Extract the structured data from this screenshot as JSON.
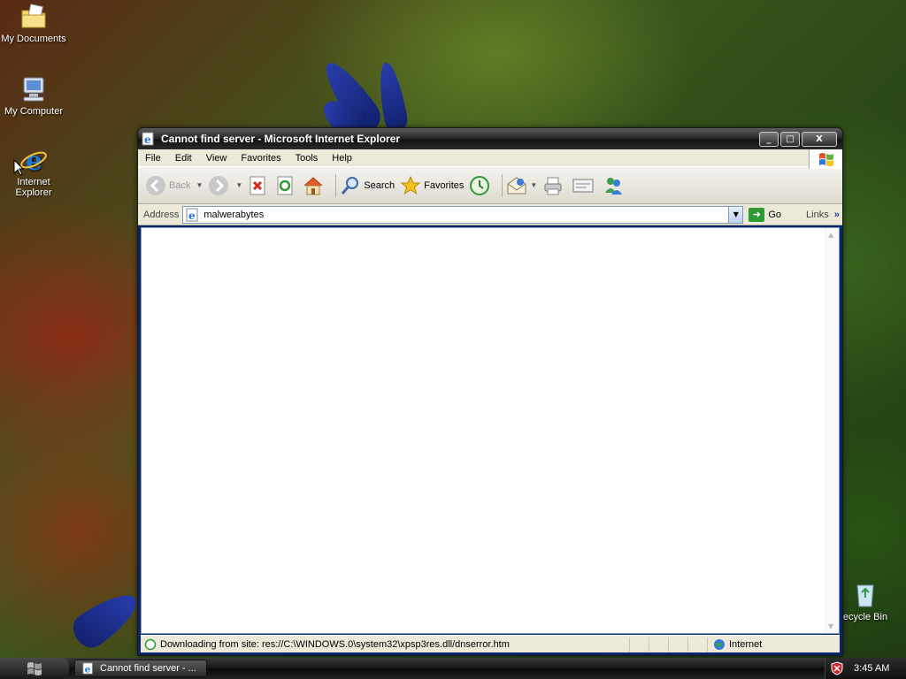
{
  "desktop": {
    "icons": [
      {
        "label": "My Documents",
        "icon": "folder-document-icon"
      },
      {
        "label": "My Computer",
        "icon": "computer-icon"
      },
      {
        "label": "Internet Explorer",
        "icon": "internet-explorer-icon"
      },
      {
        "label": "ecycle Bin",
        "icon": "recycle-bin-icon"
      }
    ]
  },
  "window": {
    "title": "Cannot find server - Microsoft Internet Explorer",
    "controls": {
      "minimize": "_",
      "maximize": "□",
      "close": "X"
    },
    "menu": [
      "File",
      "Edit",
      "View",
      "Favorites",
      "Tools",
      "Help"
    ],
    "toolbar": {
      "back": "Back",
      "search": "Search",
      "favorites": "Favorites"
    },
    "address": {
      "label": "Address",
      "value": "malwerabytes",
      "go": "Go",
      "links": "Links",
      "links_chevron": "»"
    },
    "status": {
      "message": "Downloading from site: res://C:\\WINDOWS.0\\system32\\xpsp3res.dll/dnserror.htm",
      "zone": "Internet"
    }
  },
  "taskbar": {
    "task": "Cannot find server - ...",
    "clock": "3:45 AM"
  },
  "colors": {
    "title_bar": "#2a2a2a",
    "chrome": "#ece9d8",
    "accent": "#0a246a"
  }
}
